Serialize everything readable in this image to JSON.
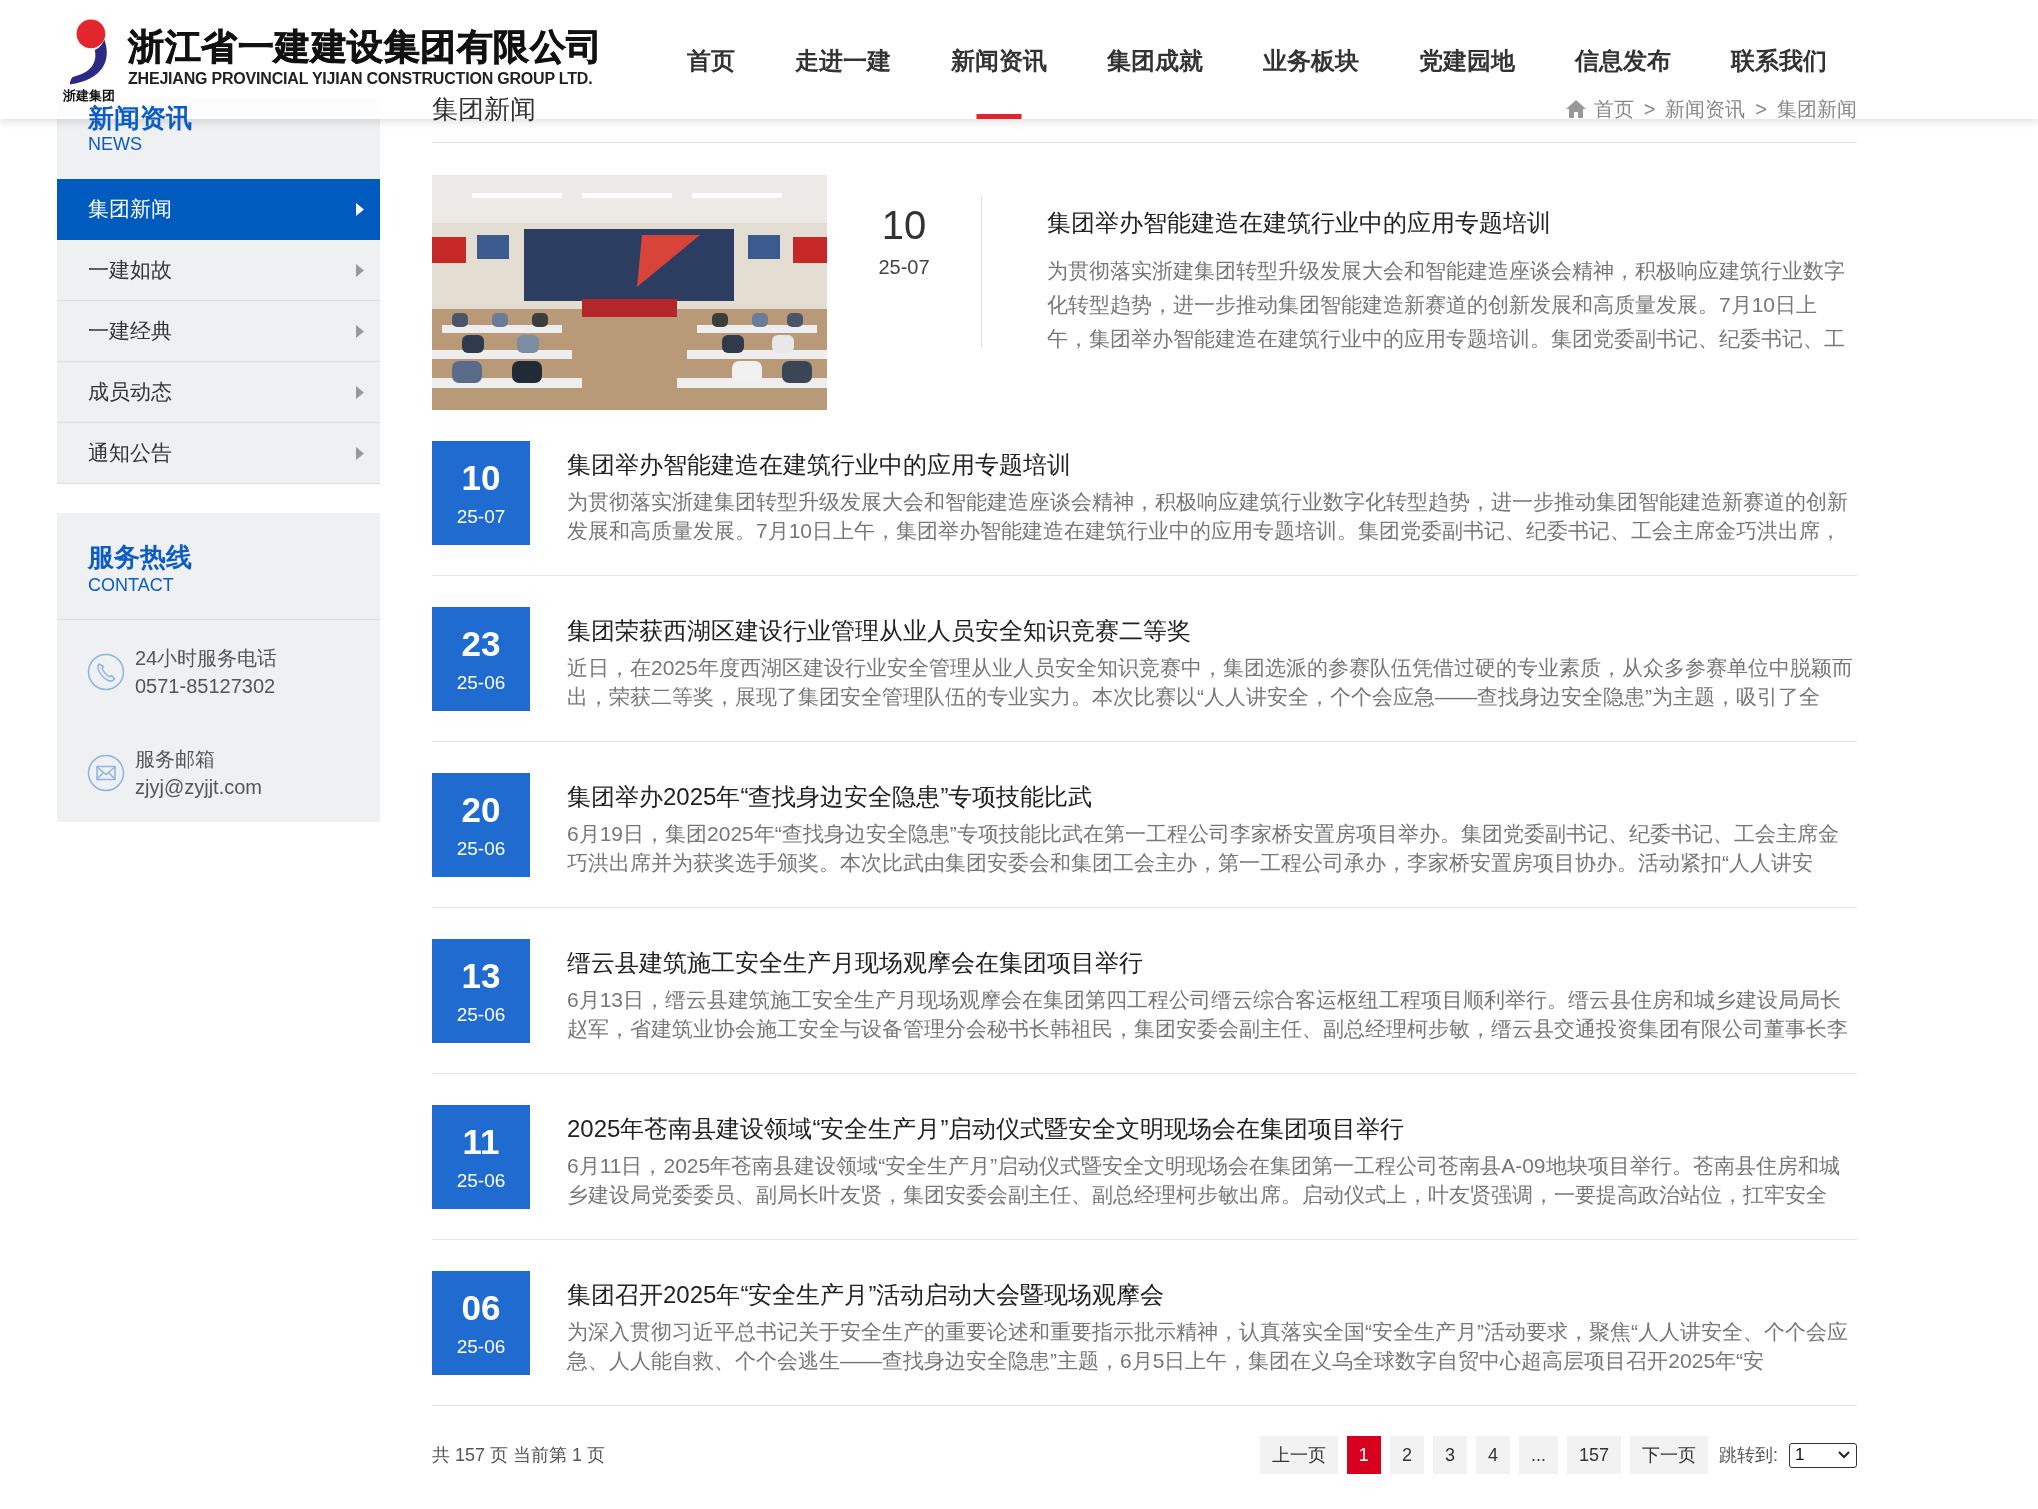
{
  "header": {
    "logo": {
      "caption": "浙建集团",
      "name": "浙江省一建建设集团有限公司",
      "name_en": "ZHEJIANG PROVINCIAL YIJIAN CONSTRUCTION GROUP LTD."
    },
    "nav": [
      {
        "label": "首页",
        "selected": false
      },
      {
        "label": "走进一建",
        "selected": false
      },
      {
        "label": "新闻资讯",
        "selected": true
      },
      {
        "label": "集团成就",
        "selected": false
      },
      {
        "label": "业务板块",
        "selected": false
      },
      {
        "label": "党建园地",
        "selected": false
      },
      {
        "label": "信息发布",
        "selected": false
      },
      {
        "label": "联系我们",
        "selected": false
      }
    ]
  },
  "sidebar": {
    "section": {
      "title": "新闻资讯",
      "subtitle": "NEWS"
    },
    "items": [
      {
        "label": "集团新闻",
        "selected": true
      },
      {
        "label": "一建如故",
        "selected": false
      },
      {
        "label": "一建经典",
        "selected": false
      },
      {
        "label": "成员动态",
        "selected": false
      },
      {
        "label": "通知公告",
        "selected": false
      }
    ],
    "contact": {
      "title": "服务热线",
      "subtitle": "CONTACT",
      "entries": [
        {
          "kind": "phone",
          "label": "24小时服务电话",
          "value": "0571-85127302"
        },
        {
          "kind": "email",
          "label": "服务邮箱",
          "value": "zjyj@zyjjt.com"
        }
      ]
    }
  },
  "page": {
    "title": "集团新闻",
    "breadcrumb": [
      {
        "kind": "home",
        "label": "首页"
      },
      {
        "kind": "separator",
        "label": ">"
      },
      {
        "kind": "link",
        "label": "新闻资讯"
      },
      {
        "kind": "separator",
        "label": ">"
      },
      {
        "kind": "current",
        "label": "集团新闻"
      }
    ]
  },
  "featured": {
    "day": "10",
    "month": "25-07",
    "title": "集团举办智能建造在建筑行业中的应用专题培训",
    "summary": "为贯彻落实浙建集团转型升级发展大会和智能建造座谈会精神，积极响应建筑行业数字化转型趋势，进一步推动集团智能建造新赛道的创新发展和高质量发展。7月10日上午，集团举办智能建造在建筑行业中的应用专题培训。集团党委副书记、纪委书记、工"
  },
  "articles": [
    {
      "day": "10",
      "month": "25-07",
      "title": "集团举办智能建造在建筑行业中的应用专题培训",
      "summary": "为贯彻落实浙建集团转型升级发展大会和智能建造座谈会精神，积极响应建筑行业数字化转型趋势，进一步推动集团智能建造新赛道的创新发展和高质量发展。7月10日上午，集团举办智能建造在建筑行业中的应用专题培训。集团党委副书记、纪委书记、工会主席金巧洪出席，"
    },
    {
      "day": "23",
      "month": "25-06",
      "title": "集团荣获西湖区建设行业管理从业人员安全知识竞赛二等奖",
      "summary": "近日，在2025年度西湖区建设行业安全管理从业人员安全知识竞赛中，集团选派的参赛队伍凭借过硬的专业素质，从众多参赛单位中脱颖而出，荣获二等奖，展现了集团安全管理队伍的专业实力。本次比赛以“人人讲安全，个个会应急——查找身边安全隐患”为主题，吸引了全"
    },
    {
      "day": "20",
      "month": "25-06",
      "title": "集团举办2025年“查找身边安全隐患”专项技能比武",
      "summary": "6月19日，集团2025年“查找身边安全隐患”专项技能比武在第一工程公司李家桥安置房项目举办。集团党委副书记、纪委书记、工会主席金巧洪出席并为获奖选手颁奖。本次比武由集团安委会和集团工会主办，第一工程公司承办，李家桥安置房项目协办。活动紧扣“人人讲安"
    },
    {
      "day": "13",
      "month": "25-06",
      "title": "缙云县建筑施工安全生产月现场观摩会在集团项目举行",
      "summary": "6月13日，缙云县建筑施工安全生产月现场观摩会在集团第四工程公司缙云综合客运枢纽工程项目顺利举行。缙云县住房和城乡建设局局长赵军，省建筑业协会施工安全与设备管理分会秘书长韩祖民，集团安委会副主任、副总经理柯步敏，缙云县交通投资集团有限公司董事长李"
    },
    {
      "day": "11",
      "month": "25-06",
      "title": "2025年苍南县建设领域“安全生产月”启动仪式暨安全文明现场会在集团项目举行",
      "summary": "6月11日，2025年苍南县建设领域“安全生产月”启动仪式暨安全文明现场会在集团第一工程公司苍南县A-09地块项目举行。苍南县住房和城乡建设局党委委员、副局长叶友贤，集团安委会副主任、副总经理柯步敏出席。启动仪式上，叶友贤强调，一要提高政治站位，扛牢安全"
    },
    {
      "day": "06",
      "month": "25-06",
      "title": "集团召开2025年“安全生产月”活动启动大会暨现场观摩会",
      "summary": "为深入贯彻习近平总书记关于安全生产的重要论述和重要指示批示精神，认真落实全国“安全生产月”活动要求，聚焦“人人讲安全、个个会应急、人人能自救、个个会逃生——查找身边安全隐患”主题，6月5日上午，集团在义乌全球数字自贸中心超高层项目召开2025年“安"
    }
  ],
  "pagination": {
    "summary": "共 157 页 当前第 1 页",
    "prev": "上一页",
    "pages": [
      {
        "label": "1",
        "selected": true
      },
      {
        "label": "2",
        "selected": false
      },
      {
        "label": "3",
        "selected": false
      },
      {
        "label": "4",
        "selected": false
      },
      {
        "label": "...",
        "selected": false
      },
      {
        "label": "157",
        "selected": false
      }
    ],
    "next": "下一页",
    "jump_label": "跳转到:",
    "jump_value": "1"
  }
}
